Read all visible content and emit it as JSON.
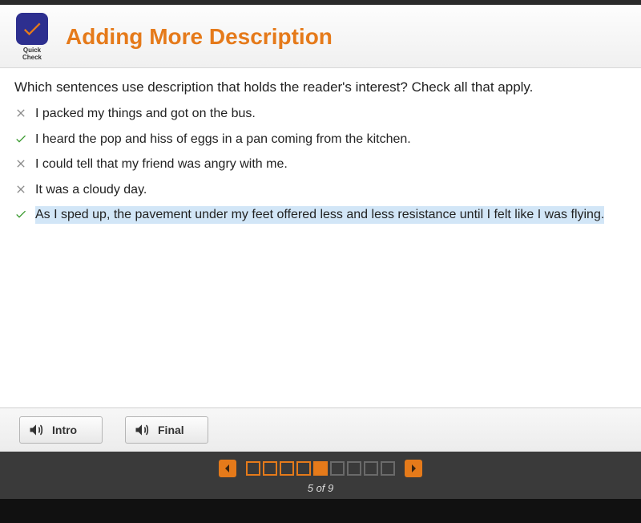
{
  "header": {
    "badge_label": "Quick Check",
    "title": "Adding More Description"
  },
  "question": "Which sentences use description that holds the reader's interest? Check all that apply.",
  "options": [
    {
      "mark": "wrong",
      "text": "I packed my things and got on the bus.",
      "highlight": false
    },
    {
      "mark": "correct",
      "text": "I heard the pop and hiss of eggs in a pan coming from the kitchen.",
      "highlight": false
    },
    {
      "mark": "wrong",
      "text": "I could tell that my friend was angry with me.",
      "highlight": false
    },
    {
      "mark": "wrong",
      "text": "It was a cloudy day.",
      "highlight": false
    },
    {
      "mark": "correct",
      "text": "As I sped up, the pavement under my feet offered less and less resistance until I felt like I was flying.",
      "highlight": true
    }
  ],
  "audio": {
    "intro_label": "Intro",
    "final_label": "Final"
  },
  "pager": {
    "current": 5,
    "total": 9,
    "counter_text": "5 of 9"
  },
  "colors": {
    "accent": "#e57a1a",
    "badge_bg": "#2d2f8f",
    "correct": "#3a9a2f",
    "wrong": "#8a8a8a",
    "highlight_bg": "#d2e6f7"
  }
}
